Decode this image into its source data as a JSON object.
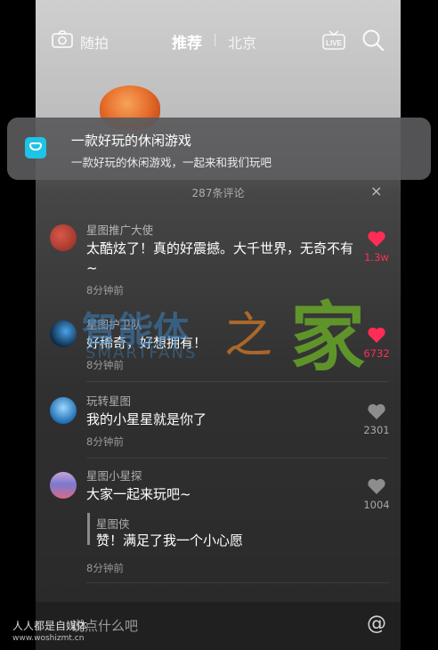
{
  "topbar": {
    "camera_label": "随拍",
    "tab_recommend": "推荐",
    "tab_city": "北京",
    "live_label": "LIVE"
  },
  "notification": {
    "title": "一款好玩的休闲游戏",
    "body": "一款好玩的休闲游戏，一起来和我们玩吧",
    "icon_color": "#1ec3e6"
  },
  "comments_panel": {
    "count_label": "287条评论",
    "close_icon": "×",
    "comments": [
      {
        "name": "星图推广大使",
        "text": "太酷炫了！真的好震撼。大千世界，无奇不有~",
        "time": "8分钟前",
        "likes": "1.3w",
        "liked": true
      },
      {
        "name": "星图护卫队",
        "text": "好稀奇，好想拥有！",
        "time": "8分钟前",
        "likes": "6732",
        "liked": true
      },
      {
        "name": "玩转星图",
        "text": "我的小星星就是你了",
        "time": "8分钟前",
        "likes": "2301",
        "liked": false
      },
      {
        "name": "星图小星探",
        "text": "大家一起来玩吧~",
        "time": "8分钟前",
        "likes": "1004",
        "liked": false,
        "reply": {
          "name": "星图侠",
          "text": "赞！满足了我一个小心愿"
        }
      }
    ],
    "input_placeholder": "说点什么吧",
    "at_icon": "@"
  },
  "watermarks": {
    "credit_text": "人人都是自媒体",
    "credit_url": "www.woshizmt.cn",
    "logo_cn": "智能体",
    "logo_zhi": "之",
    "logo_jia": "家",
    "logo_en": "SMARTFANS"
  },
  "colors": {
    "like_active": "#ff2d55",
    "like_inactive": "#9a9a9a",
    "app_accent": "#1ec3e6"
  }
}
